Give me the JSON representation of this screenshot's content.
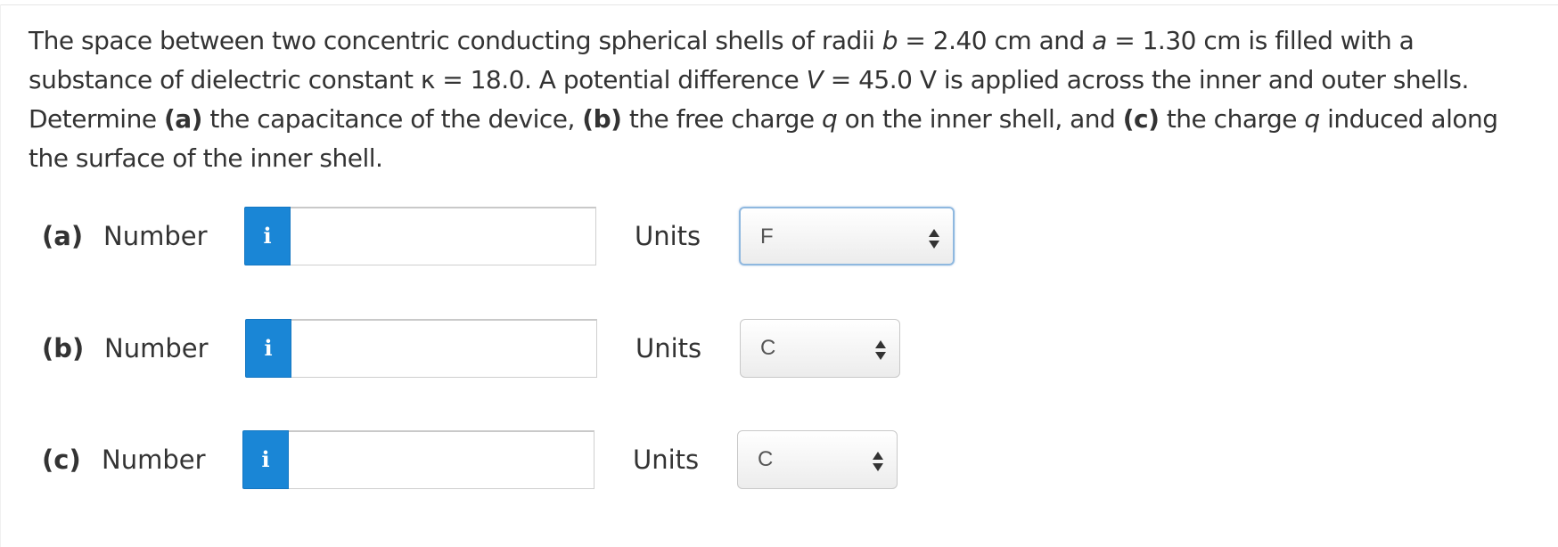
{
  "question": {
    "t1": "The space between two concentric conducting spherical shells of radii ",
    "var_b": "b",
    "t2": " = 2.40 cm and ",
    "var_a": "a",
    "t3": " = 1.30 cm is filled with a substance of dielectric constant κ = 18.0. A potential difference ",
    "var_V": "V",
    "t4": " = 45.0 V is applied across the inner and outer shells. Determine ",
    "part_a": "(a)",
    "t5": " the capacitance of the device, ",
    "part_b": "(b)",
    "t6": " the free charge ",
    "var_q1": "q",
    "t7": " on the inner shell, and ",
    "part_c": "(c)",
    "t8": " the charge ",
    "var_q2": "q",
    "t9": " induced along the surface of the inner shell."
  },
  "parts": [
    {
      "label": "(a)",
      "number_label": "Number",
      "info_icon": "i",
      "value": "",
      "units_label": "Units",
      "unit": "F"
    },
    {
      "label": "(b)",
      "number_label": "Number",
      "info_icon": "i",
      "value": "",
      "units_label": "Units",
      "unit": "C"
    },
    {
      "label": "(c)",
      "number_label": "Number",
      "info_icon": "i",
      "value": "",
      "units_label": "Units",
      "unit": "C"
    }
  ],
  "colors": {
    "info_button": "#1a86d6",
    "text": "#333333",
    "focus_border": "#8fb8df"
  },
  "icons": {
    "info": "info-icon",
    "select_arrows": "up-down-arrows-icon"
  }
}
